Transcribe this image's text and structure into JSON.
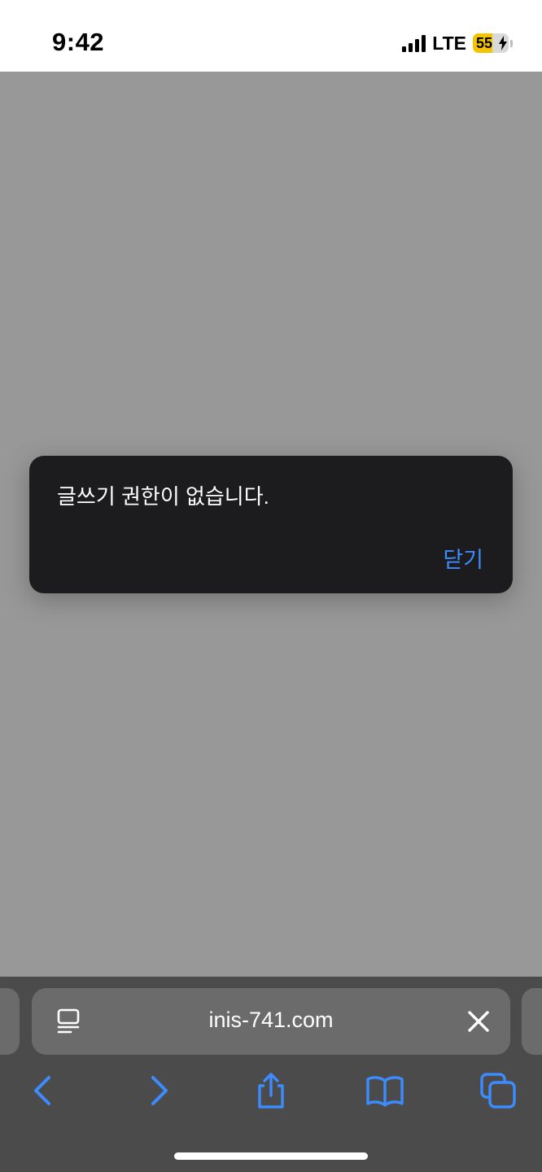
{
  "status_bar": {
    "time": "9:42",
    "network": "LTE",
    "battery_level": "55",
    "battery_fraction": 0.55,
    "battery_color": "#f5c400"
  },
  "dialog": {
    "message": "글쓰기 권한이 없습니다.",
    "close_label": "닫기",
    "accent_color": "#3d8cff"
  },
  "browser": {
    "url": "inis-741.com",
    "reader_icon": "reader-icon",
    "clear_icon": "close-icon",
    "toolbar_icons": [
      "back-icon",
      "forward-icon",
      "share-icon",
      "bookmarks-icon",
      "tabs-icon"
    ],
    "icon_color": "#3d8cff"
  }
}
